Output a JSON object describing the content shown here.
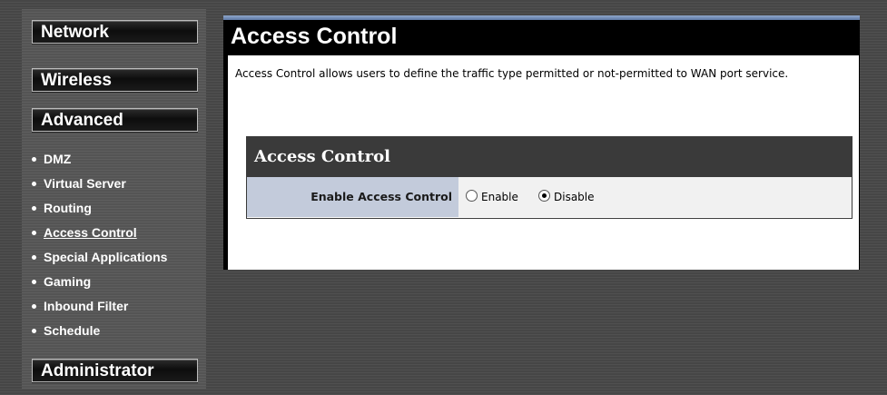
{
  "sidebar": {
    "network": "Network",
    "wireless": "Wireless",
    "advanced": "Advanced",
    "administrator": "Administrator",
    "items": [
      {
        "label": "DMZ"
      },
      {
        "label": "Virtual Server"
      },
      {
        "label": "Routing"
      },
      {
        "label": "Access Control",
        "active": true
      },
      {
        "label": "Special Applications"
      },
      {
        "label": "Gaming"
      },
      {
        "label": "Inbound Filter"
      },
      {
        "label": "Schedule"
      }
    ]
  },
  "main": {
    "title": "Access Control",
    "description": "Access Control allows users to define the traffic type permitted or not-permitted to WAN port service.",
    "section": {
      "title": "Access Control",
      "field_label": "Enable Access Control",
      "options": {
        "enable": "Enable",
        "disable": "Disable"
      },
      "selected": "Disable"
    }
  },
  "colors": {
    "accent_bar": "#7b94bd",
    "label_bg": "#c3cbdb",
    "panel_bg": "#000000"
  }
}
